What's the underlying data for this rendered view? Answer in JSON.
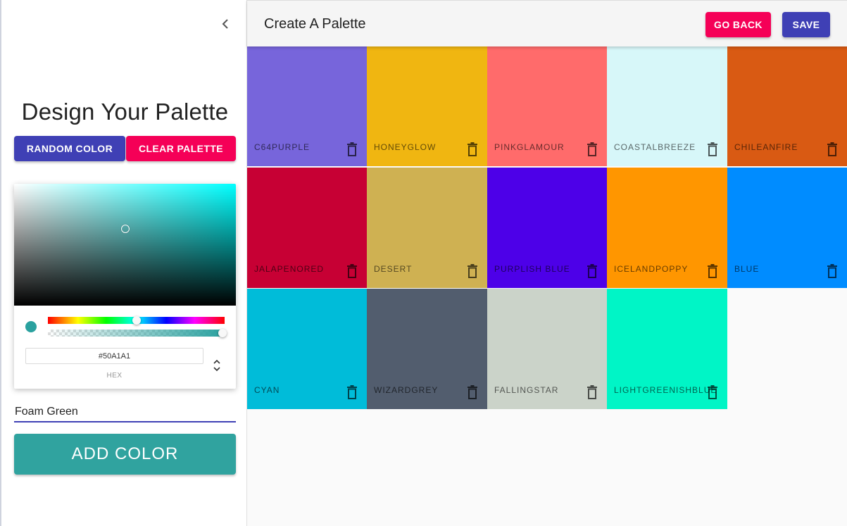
{
  "drawer": {
    "title": "Design Your Palette",
    "random_label": "Random Color",
    "clear_label": "Clear Palette",
    "picker": {
      "hex_value": "#50A1A1",
      "hex_label": "HEX",
      "preview_color": "#2aa19f"
    },
    "name_value": "Foam Green",
    "add_label": "Add Color"
  },
  "header": {
    "title": "Create A Palette",
    "back_label": "Go Back",
    "save_label": "Save"
  },
  "colors": {
    "accent_primary": "#3f40b5",
    "accent_secondary": "#f50057",
    "add_button": "#30a39f"
  },
  "palette": [
    {
      "name": "C64PURPLE",
      "color": "#7765db"
    },
    {
      "name": "HONEYGLOW",
      "color": "#f0b611"
    },
    {
      "name": "PINKGLAMOUR",
      "color": "#ff6b6b"
    },
    {
      "name": "COASTALBREEZE",
      "color": "#d7f7f9"
    },
    {
      "name": "CHILEANFIRE",
      "color": "#d95a13"
    },
    {
      "name": "JALAPENORED",
      "color": "#c70034"
    },
    {
      "name": "DESERT",
      "color": "#cfb152"
    },
    {
      "name": "PURPLISH BLUE",
      "color": "#4d00e8"
    },
    {
      "name": "ICELANDPOPPY",
      "color": "#ff9600"
    },
    {
      "name": "BLUE",
      "color": "#008cff"
    },
    {
      "name": "CYAN",
      "color": "#00bcd9"
    },
    {
      "name": "WIZARDGREY",
      "color": "#525d6e"
    },
    {
      "name": "FALLINGSTAR",
      "color": "#cbd3c9"
    },
    {
      "name": "LIGHTGREENISHBLUE",
      "color": "#00f5c6"
    }
  ]
}
